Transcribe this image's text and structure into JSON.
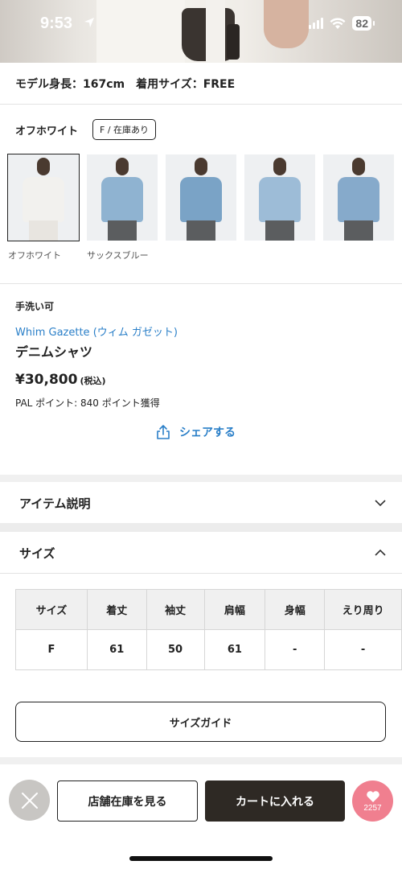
{
  "status_bar": {
    "time": "9:53",
    "battery": "82"
  },
  "model": {
    "info": "モデル身長：167cm　着用サイズ：FREE"
  },
  "color_selector": {
    "selected_color": "オフホワイト",
    "stock_badge": "F / 在庫あり",
    "thumbnails": [
      {
        "label": "オフホワイト",
        "color": "#f2f1ee"
      },
      {
        "label": "サックスブルー",
        "color": "#8fb3d1"
      },
      {
        "label": "",
        "color": "#7aa3c6"
      },
      {
        "label": "",
        "color": "#9dbcd7"
      },
      {
        "label": "",
        "color": "#86aacb"
      }
    ]
  },
  "product": {
    "care": "手洗い可",
    "brand": "Whim Gazette (ウィム ガゼット)",
    "name": "デニムシャツ",
    "price": "¥30,800",
    "tax_note": "(税込)",
    "points": "PAL ポイント: 840 ポイント獲得",
    "share_label": "シェアする"
  },
  "accordions": {
    "item_description": "アイテム説明",
    "size": "サイズ"
  },
  "size_table": {
    "headers": [
      "サイズ",
      "着丈",
      "袖丈",
      "肩幅",
      "身幅",
      "えり周り"
    ],
    "rows": [
      [
        "F",
        "61",
        "50",
        "61",
        "-",
        "-"
      ]
    ]
  },
  "size_guide_label": "サイズガイド",
  "bottom_bar": {
    "store_stock_label": "店舗在庫を見る",
    "cart_label": "カートに入れる",
    "favorite_count": "2257"
  },
  "colors": {
    "link_blue": "#2a7fc8",
    "cart_dark": "#2e2924",
    "favorite_pink": "#f07f8f"
  }
}
